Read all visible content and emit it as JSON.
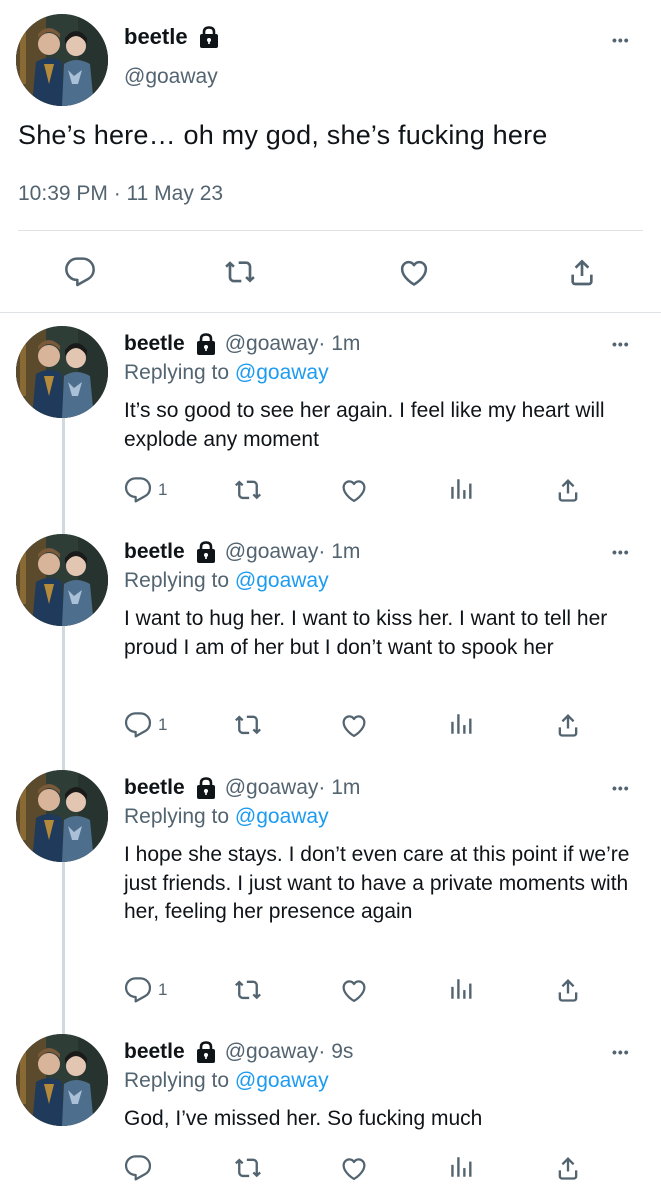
{
  "main_tweet": {
    "display_name": "beetle",
    "handle": "@goaway",
    "text": "She’s here… oh my god, she’s fucking here",
    "timestamp": "10:39 PM · 11 May 23",
    "more_label": "•••"
  },
  "replies": [
    {
      "display_name": "beetle",
      "handle": "@goaway",
      "time": " · 1m",
      "replying_prefix": "Replying to ",
      "replying_to": "@goaway",
      "text": "It’s so good to see her again. I feel like my heart will explode any moment",
      "reply_count": "1",
      "more_label": "•••"
    },
    {
      "display_name": "beetle",
      "handle": "@goaway",
      "time": " · 1m",
      "replying_prefix": "Replying to ",
      "replying_to": "@goaway",
      "text": "I want to hug her. I want to kiss her. I want to tell her proud I am of her but I don’t want to spook her",
      "reply_count": "1",
      "more_label": "•••"
    },
    {
      "display_name": "beetle",
      "handle": "@goaway",
      "time": " · 1m",
      "replying_prefix": "Replying to ",
      "replying_to": "@goaway",
      "text": "I hope she stays. I don’t even care at this point if we’re just friends. I just want to have a private moments with her, feeling her presence again",
      "reply_count": "1",
      "more_label": "•••"
    },
    {
      "display_name": "beetle",
      "handle": "@goaway",
      "time": " · 9s",
      "replying_prefix": "Replying to ",
      "replying_to": "@goaway",
      "text": "God, I’ve missed her. So fucking much",
      "reply_count": "",
      "more_label": "•••"
    }
  ],
  "icons": {
    "reply": "reply-icon",
    "retweet": "retweet-icon",
    "like": "like-icon",
    "analytics": "analytics-icon",
    "share": "share-icon",
    "lock": "lock-icon",
    "more": "more-icon"
  },
  "colors": {
    "text": "#0f1419",
    "secondary": "#536471",
    "link": "#1d9bf0",
    "divider": "#dfe3e6"
  }
}
